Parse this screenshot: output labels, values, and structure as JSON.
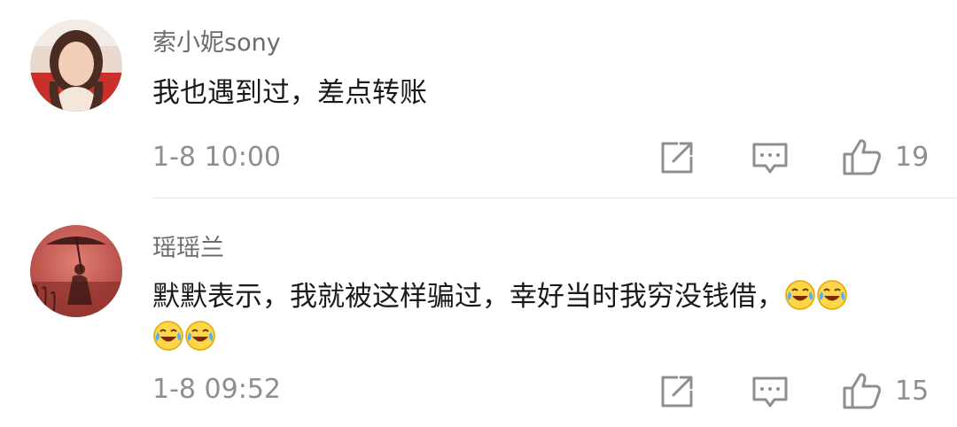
{
  "comments": [
    {
      "username": "索小妮sony",
      "text": "我也遇到过，差点转账",
      "emoji_after_text": [],
      "time": "1-8 10:00",
      "likes": "19",
      "avatar_icon": "woman-portrait-avatar"
    },
    {
      "username": "瑶瑶兰",
      "text": "默默表示，我就被这样骗过，幸好当时我穷没钱借，",
      "emoji_after_text": [
        "laughing-crying-emoji",
        "laughing-crying-emoji",
        "laughing-crying-emoji",
        "laughing-crying-emoji"
      ],
      "time": "1-8 09:52",
      "likes": "15",
      "avatar_icon": "umbrella-silhouette-avatar"
    }
  ],
  "colors": {
    "username": "#6b6b6b",
    "text": "#1a1a1a",
    "meta": "#8e8e8e",
    "divider": "#e7e7e7"
  },
  "icons": {
    "share": "share-icon",
    "reply": "comment-icon",
    "like": "thumbs-up-icon"
  }
}
